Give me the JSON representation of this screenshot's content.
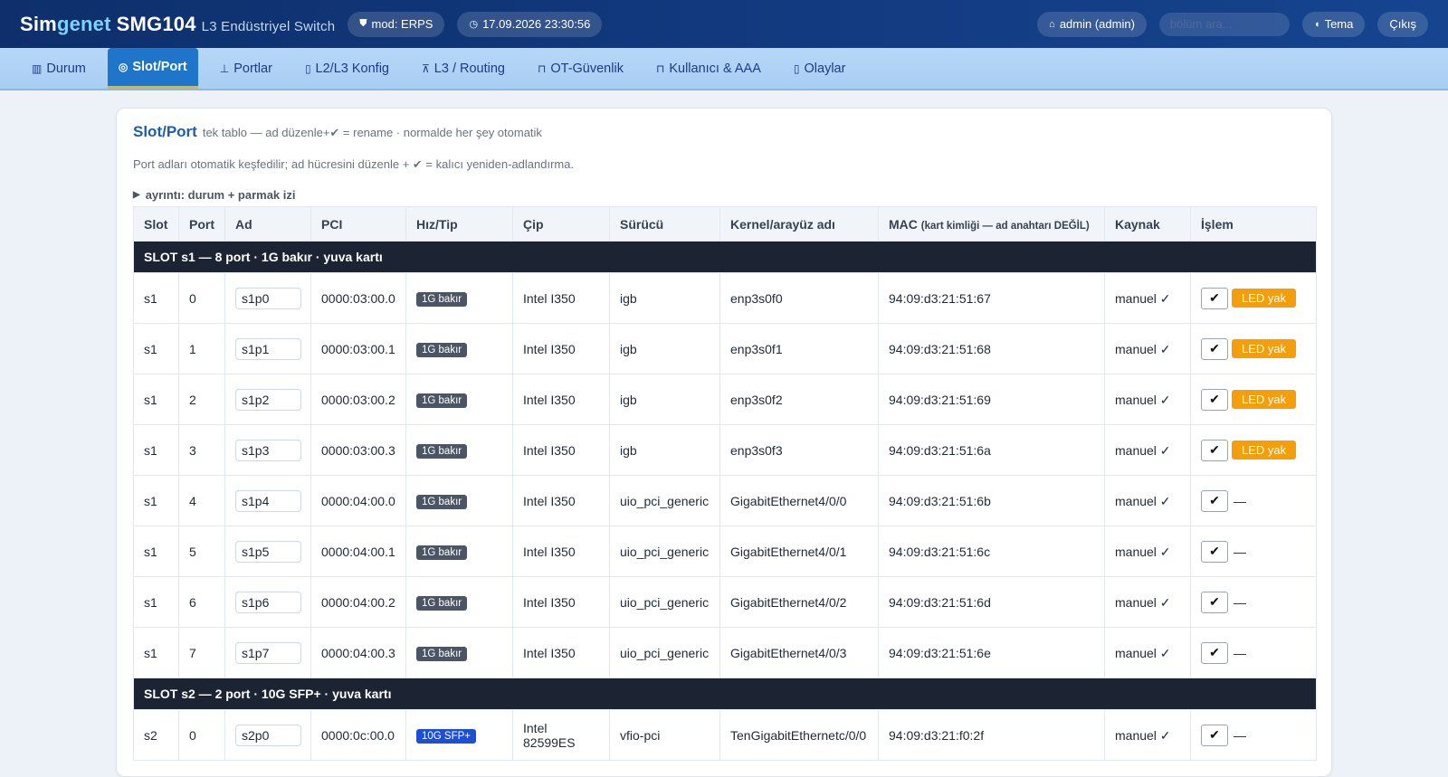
{
  "header": {
    "brand_a": "Sim",
    "brand_b": "genet",
    "brand_c": "SMG104",
    "brand_sub": "L3 Endüstriyel Switch",
    "mode": "mod: ERPS",
    "datetime": "17.09.2026 23:30:56",
    "user": "admin (admin)",
    "search_placeholder": "bölüm ara...",
    "theme": "Tema",
    "logout": "Çıkış"
  },
  "nav": [
    {
      "label": "Durum",
      "icon": "bar-chart-icon"
    },
    {
      "label": "Slot/Port",
      "icon": "target-icon",
      "active": true
    },
    {
      "label": "Portlar",
      "icon": "plug-icon"
    },
    {
      "label": "L2/L3 Konfig",
      "icon": "doc-icon"
    },
    {
      "label": "L3 / Routing",
      "icon": "network-icon"
    },
    {
      "label": "OT-Güvenlik",
      "icon": "lock-icon"
    },
    {
      "label": "Kullanıcı & AAA",
      "icon": "user-lock-icon"
    },
    {
      "label": "Olaylar",
      "icon": "clipboard-icon"
    }
  ],
  "panel": {
    "title": "Slot/Port",
    "subtitle": "tek tablo — ad düzenle+✔ = rename · normalde her şey otomatik",
    "description": "Port adları otomatik keşfedilir; ad hücresini düzenle + ✔ = kalıcı yeniden-adlandırma.",
    "details": "ayrıntı: durum + parmak izi"
  },
  "table": {
    "headers": {
      "slot": "Slot",
      "port": "Port",
      "ad": "Ad",
      "pci": "PCI",
      "hiz": "Hız/Tip",
      "cip": "Çip",
      "surucu": "Sürücü",
      "kernel": "Kernel/arayüz adı",
      "mac": "MAC",
      "mac_note": "(kart kimliği — ad anahtarı DEĞİL)",
      "kaynak": "Kaynak",
      "islem": "İşlem"
    },
    "slot1_label": "SLOT s1 — 8 port · 1G bakır · yuva kartı",
    "slot2_label": "SLOT s2 — 2 port · 10G SFP+ · yuva kartı",
    "check": "✔",
    "led": "LED yak",
    "dash": "—",
    "rows": [
      {
        "slot": "s1",
        "port": "0",
        "name": "s1p0",
        "pci": "0000:03:00.0",
        "speed": "1G bakır",
        "chip": "Intel I350",
        "driver": "igb",
        "kernel": "enp3s0f0",
        "mac": "94:09:d3:21:51:67",
        "source": "manuel ✓"
      },
      {
        "slot": "s1",
        "port": "1",
        "name": "s1p1",
        "pci": "0000:03:00.1",
        "speed": "1G bakır",
        "chip": "Intel I350",
        "driver": "igb",
        "kernel": "enp3s0f1",
        "mac": "94:09:d3:21:51:68",
        "source": "manuel ✓"
      },
      {
        "slot": "s1",
        "port": "2",
        "name": "s1p2",
        "pci": "0000:03:00.2",
        "speed": "1G bakır",
        "chip": "Intel I350",
        "driver": "igb",
        "kernel": "enp3s0f2",
        "mac": "94:09:d3:21:51:69",
        "source": "manuel ✓"
      },
      {
        "slot": "s1",
        "port": "3",
        "name": "s1p3",
        "pci": "0000:03:00.3",
        "speed": "1G bakır",
        "chip": "Intel I350",
        "driver": "igb",
        "kernel": "enp3s0f3",
        "mac": "94:09:d3:21:51:6a",
        "source": "manuel ✓"
      },
      {
        "slot": "s1",
        "port": "4",
        "name": "s1p4",
        "pci": "0000:04:00.0",
        "speed": "1G bakır",
        "chip": "Intel I350",
        "driver": "uio_pci_generic",
        "kernel": "GigabitEthernet4/0/0",
        "mac": "94:09:d3:21:51:6b",
        "source": "manuel ✓"
      },
      {
        "slot": "s1",
        "port": "5",
        "name": "s1p5",
        "pci": "0000:04:00.1",
        "speed": "1G bakır",
        "chip": "Intel I350",
        "driver": "uio_pci_generic",
        "kernel": "GigabitEthernet4/0/1",
        "mac": "94:09:d3:21:51:6c",
        "source": "manuel ✓"
      },
      {
        "slot": "s1",
        "port": "6",
        "name": "s1p6",
        "pci": "0000:04:00.2",
        "speed": "1G bakır",
        "chip": "Intel I350",
        "driver": "uio_pci_generic",
        "kernel": "GigabitEthernet4/0/2",
        "mac": "94:09:d3:21:51:6d",
        "source": "manuel ✓"
      },
      {
        "slot": "s1",
        "port": "7",
        "name": "s1p7",
        "pci": "0000:04:00.3",
        "speed": "1G bakır",
        "chip": "Intel I350",
        "driver": "uio_pci_generic",
        "kernel": "GigabitEthernet4/0/3",
        "mac": "94:09:d3:21:51:6e",
        "source": "manuel ✓"
      },
      {
        "slot": "s2",
        "port": "0",
        "name": "s2p0",
        "pci": "0000:0c:00.0",
        "speed": "10G SFP+",
        "chip": "Intel 82599ES",
        "driver": "vfio-pci",
        "kernel": "TenGigabitEthernetc/0/0",
        "mac": "94:09:d3:21:f0:2f",
        "source": "manuel ✓"
      }
    ]
  }
}
